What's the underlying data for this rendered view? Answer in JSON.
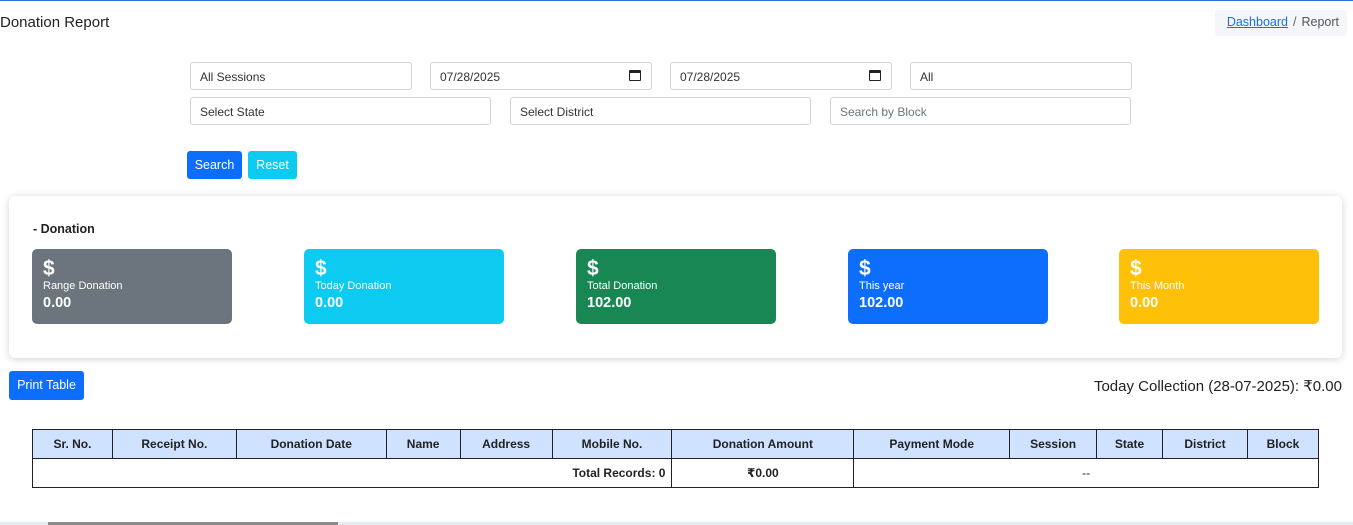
{
  "page": {
    "title": "Donation Report"
  },
  "breadcrumb": {
    "link": "Dashboard",
    "separator": "/",
    "current": "Report"
  },
  "filters": {
    "session": "All Sessions",
    "from_date": "07/28/2025",
    "to_date": "07/28/2025",
    "payment_mode": "All",
    "state_placeholder": "Select State",
    "district_placeholder": "Select District",
    "block_placeholder": "Search by Block"
  },
  "buttons": {
    "search": "Search",
    "reset": "Reset",
    "print": "Print Table"
  },
  "summary": {
    "heading": "- Donation",
    "cards": [
      {
        "icon": "$",
        "label": "Range Donation",
        "value": "0.00",
        "color": "#6c757d"
      },
      {
        "icon": "$",
        "label": "Today Donation",
        "value": "0.00",
        "color": "#0dcaf0"
      },
      {
        "icon": "$",
        "label": "Total Donation",
        "value": "102.00",
        "color": "#198754"
      },
      {
        "icon": "$",
        "label": "This year",
        "value": "102.00",
        "color": "#0d6efd"
      },
      {
        "icon": "$",
        "label": "This Month",
        "value": "0.00",
        "color": "#ffc107"
      }
    ]
  },
  "today_collection": "Today Collection (28-07-2025): ₹0.00",
  "table": {
    "columns": [
      "Sr. No.",
      "Receipt No.",
      "Donation Date",
      "Name",
      "Address",
      "Mobile No.",
      "Donation Amount",
      "Payment Mode",
      "Session",
      "State",
      "District",
      "Block"
    ],
    "footer": {
      "total_records": "Total Records: 0",
      "total_amount": "₹0.00",
      "rest": "--"
    }
  }
}
